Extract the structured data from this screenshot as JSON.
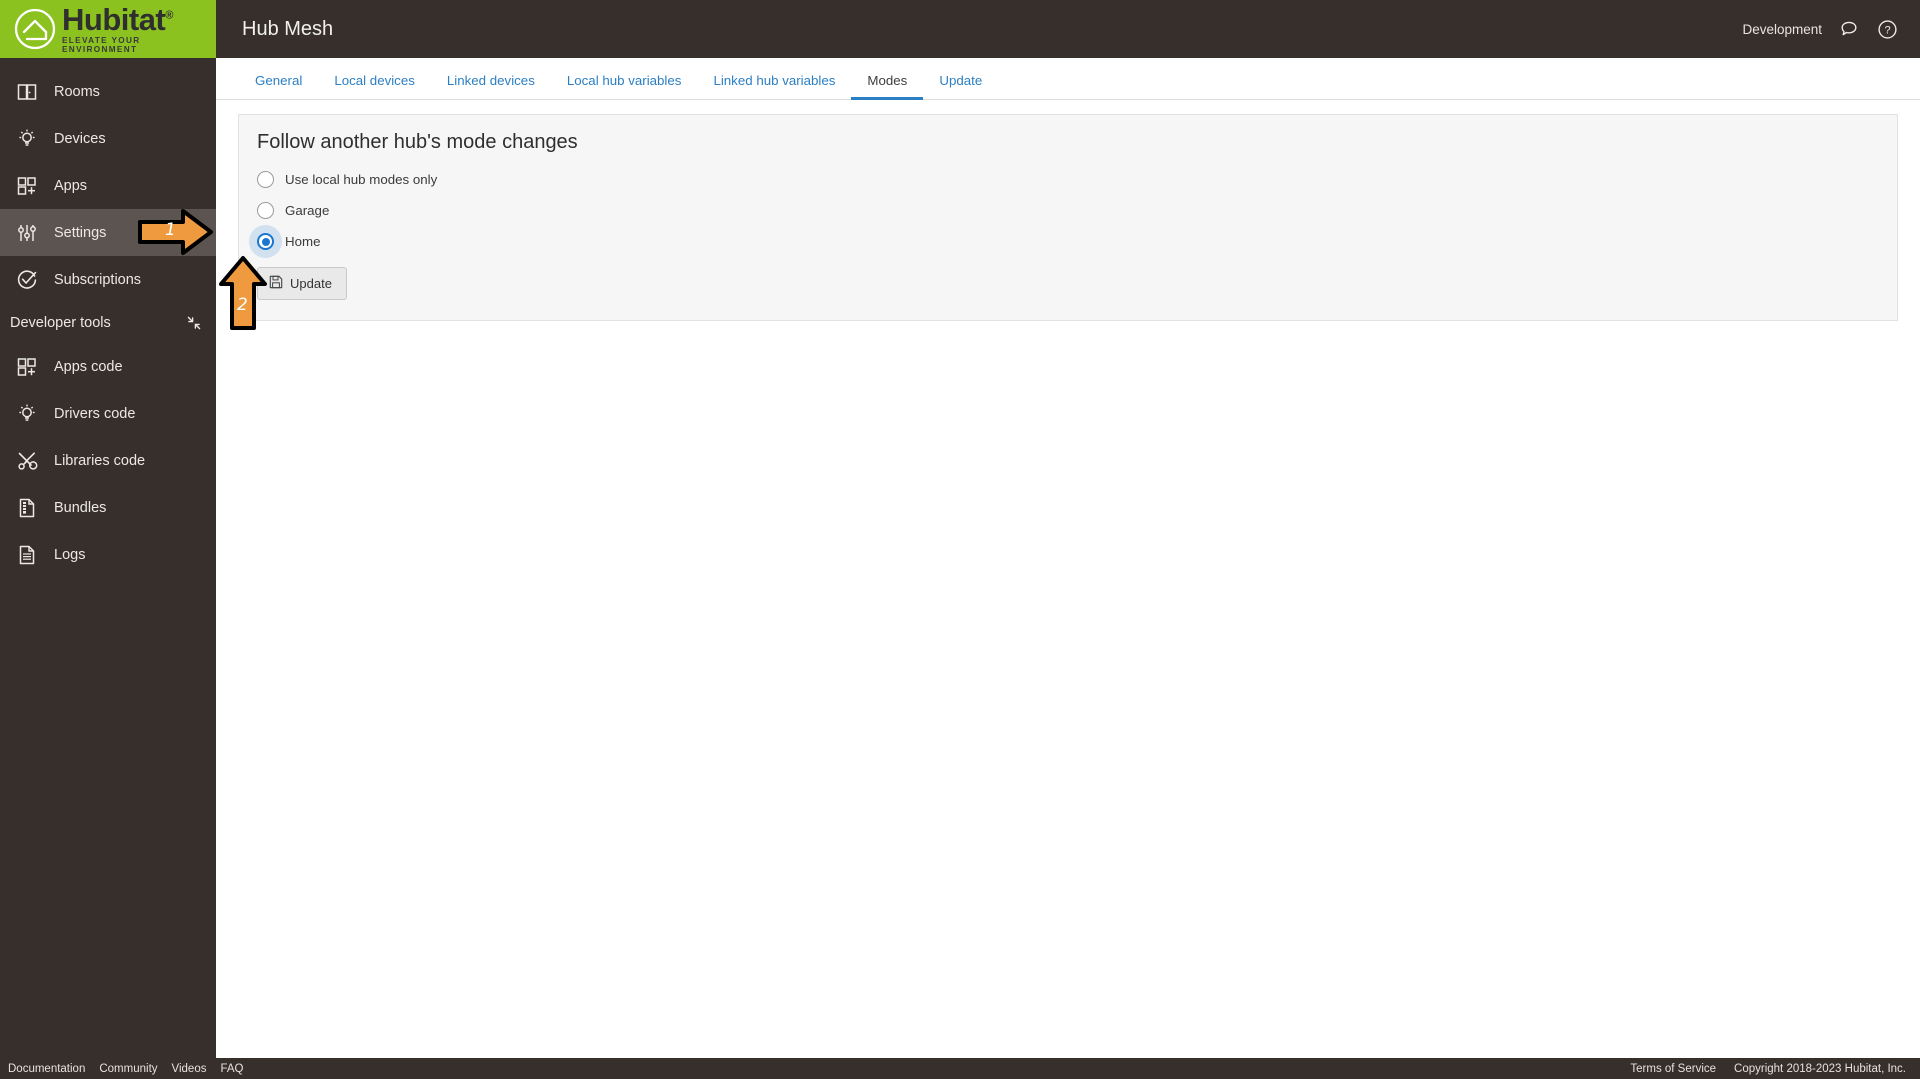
{
  "brand": {
    "name": "Hubitat",
    "trademark": "®",
    "tagline": "ELEVATE YOUR ENVIRONMENT",
    "logo_bg": "#8bc220",
    "chrome_bg": "#362f2b"
  },
  "topbar": {
    "title": "Hub Mesh",
    "environment": "Development",
    "icons": [
      {
        "name": "chat-bubble-icon",
        "label": "Support chat"
      },
      {
        "name": "help-circle-icon",
        "label": "Help"
      }
    ]
  },
  "sidebar": {
    "items": [
      {
        "label": "Rooms",
        "icon": "rooms-icon",
        "active": false
      },
      {
        "label": "Devices",
        "icon": "device-bulb-icon",
        "active": false
      },
      {
        "label": "Apps",
        "icon": "apps-grid-icon",
        "active": false
      },
      {
        "label": "Settings",
        "icon": "sliders-icon",
        "active": true
      },
      {
        "label": "Subscriptions",
        "icon": "check-circle-icon",
        "active": false
      }
    ],
    "section": {
      "label": "Developer tools",
      "collapse_icon": "collapse-arrows-icon",
      "items": [
        {
          "label": "Apps code",
          "icon": "apps-grid-icon"
        },
        {
          "label": "Drivers code",
          "icon": "device-bulb-icon"
        },
        {
          "label": "Libraries code",
          "icon": "tools-icon"
        },
        {
          "label": "Bundles",
          "icon": "bundle-doc-icon"
        },
        {
          "label": "Logs",
          "icon": "document-lines-icon"
        }
      ]
    }
  },
  "tabs": [
    {
      "label": "General",
      "active": false
    },
    {
      "label": "Local devices",
      "active": false
    },
    {
      "label": "Linked devices",
      "active": false
    },
    {
      "label": "Local hub variables",
      "active": false
    },
    {
      "label": "Linked hub variables",
      "active": false
    },
    {
      "label": "Modes",
      "active": true
    },
    {
      "label": "Update",
      "active": false
    }
  ],
  "panel": {
    "title": "Follow another hub's mode changes",
    "options": [
      {
        "label": "Use local hub modes only",
        "selected": false
      },
      {
        "label": "Garage",
        "selected": false
      },
      {
        "label": "Home",
        "selected": true
      }
    ],
    "submit": {
      "label": "Update",
      "icon": "save-floppy-icon"
    }
  },
  "annotations": [
    {
      "number": "1",
      "direction": "right",
      "color": "#f09a40"
    },
    {
      "number": "2",
      "direction": "up",
      "color": "#f09a40"
    }
  ],
  "footer": {
    "links": [
      "Documentation",
      "Community",
      "Videos",
      "FAQ"
    ],
    "terms": "Terms of Service",
    "copyright": "Copyright 2018-2023 Hubitat, Inc."
  },
  "colors": {
    "accent_link": "#2b7fc4",
    "radio_selected": "#1b76d2",
    "annotation_orange": "#f09a40"
  }
}
